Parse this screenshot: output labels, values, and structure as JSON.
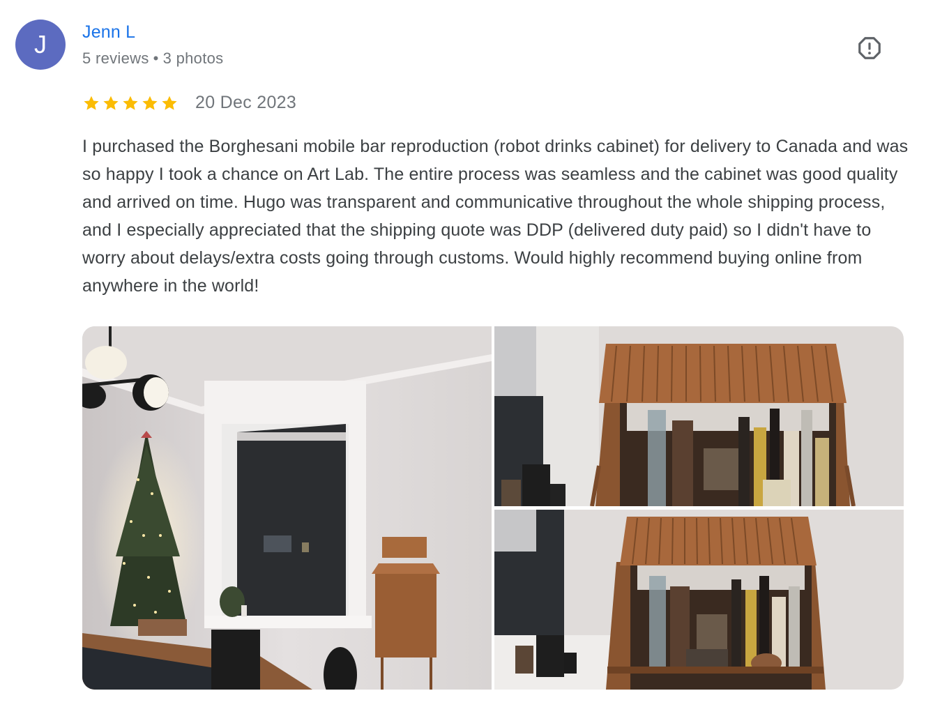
{
  "reviewer": {
    "initial": "J",
    "avatar_color": "#5c6bc0",
    "name": "Jenn L",
    "reviews": "5 reviews",
    "separator": "•",
    "photos": "3 photos"
  },
  "report_icon": "report-flag-icon",
  "rating": {
    "stars": 5,
    "max": 5,
    "star_color": "#fbbc04",
    "date": "20 Dec 2023"
  },
  "review": {
    "text": "I purchased the Borghesani mobile bar reproduction (robot drinks cabinet) for delivery to Canada and was so happy I took a chance on Art Lab. The entire process was seamless and the cabinet was good quality and arrived on time. Hugo was transparent and communicative throughout the whole shipping process, and I especially appreciated that the shipping quote was DDP (delivered duty paid) so I didn't have to worry about delays/extra costs going through customs. Would highly recommend buying online from anywhere in the world!"
  },
  "photos": [
    {
      "name": "dining-room-photo"
    },
    {
      "name": "bar-cabinet-photo-1"
    },
    {
      "name": "bar-cabinet-photo-2"
    }
  ]
}
